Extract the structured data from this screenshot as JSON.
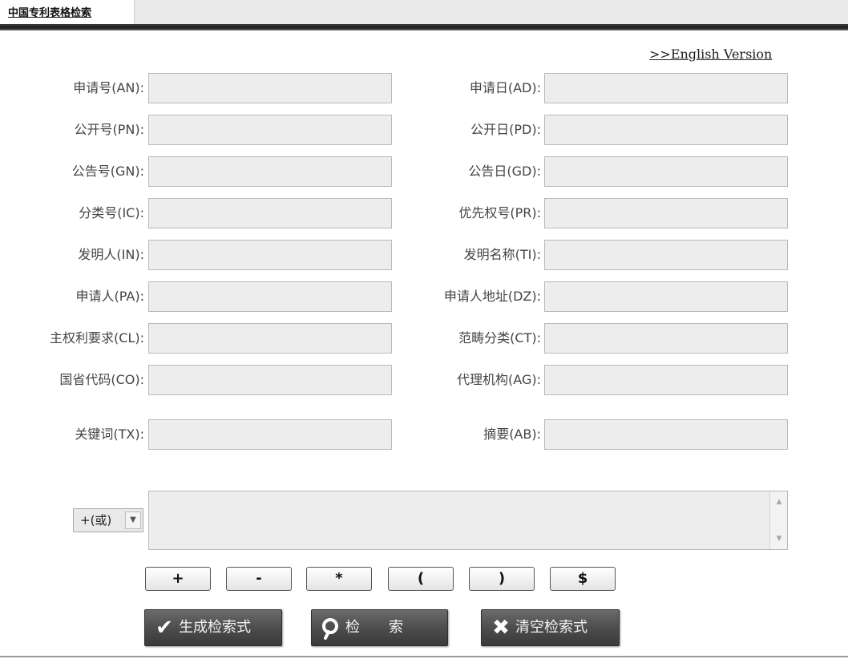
{
  "header": {
    "tab_title": "中国专利表格检索"
  },
  "english_link": ">>English Version",
  "fields": {
    "left": [
      {
        "label": "申请号(AN):",
        "value": ""
      },
      {
        "label": "公开号(PN):",
        "value": ""
      },
      {
        "label": "公告号(GN):",
        "value": ""
      },
      {
        "label": "分类号(IC):",
        "value": ""
      },
      {
        "label": "发明人(IN):",
        "value": ""
      },
      {
        "label": "申请人(PA):",
        "value": ""
      },
      {
        "label": "主权利要求(CL):",
        "value": ""
      },
      {
        "label": "国省代码(CO):",
        "value": ""
      },
      {
        "label": "关键词(TX):",
        "value": ""
      }
    ],
    "right": [
      {
        "label": "申请日(AD):",
        "value": ""
      },
      {
        "label": "公开日(PD):",
        "value": ""
      },
      {
        "label": "公告日(GD):",
        "value": ""
      },
      {
        "label": "优先权号(PR):",
        "value": ""
      },
      {
        "label": "发明名称(TI):",
        "value": ""
      },
      {
        "label": "申请人地址(DZ):",
        "value": ""
      },
      {
        "label": "范畴分类(CT):",
        "value": ""
      },
      {
        "label": "代理机构(AG):",
        "value": ""
      },
      {
        "label": "摘要(AB):",
        "value": ""
      }
    ]
  },
  "operator_select": {
    "selected": "+(或)",
    "arrow_icon": "chevron-down-icon"
  },
  "expression": {
    "value": ""
  },
  "operator_buttons": [
    "+",
    "-",
    "*",
    "(",
    ")",
    "$"
  ],
  "actions": {
    "generate": {
      "label": "生成检索式",
      "icon": "checkmark-icon"
    },
    "search": {
      "label": "检　　索",
      "icon": "magnifier-icon"
    },
    "clear": {
      "label": "清空检索式",
      "icon": "x-icon"
    }
  }
}
